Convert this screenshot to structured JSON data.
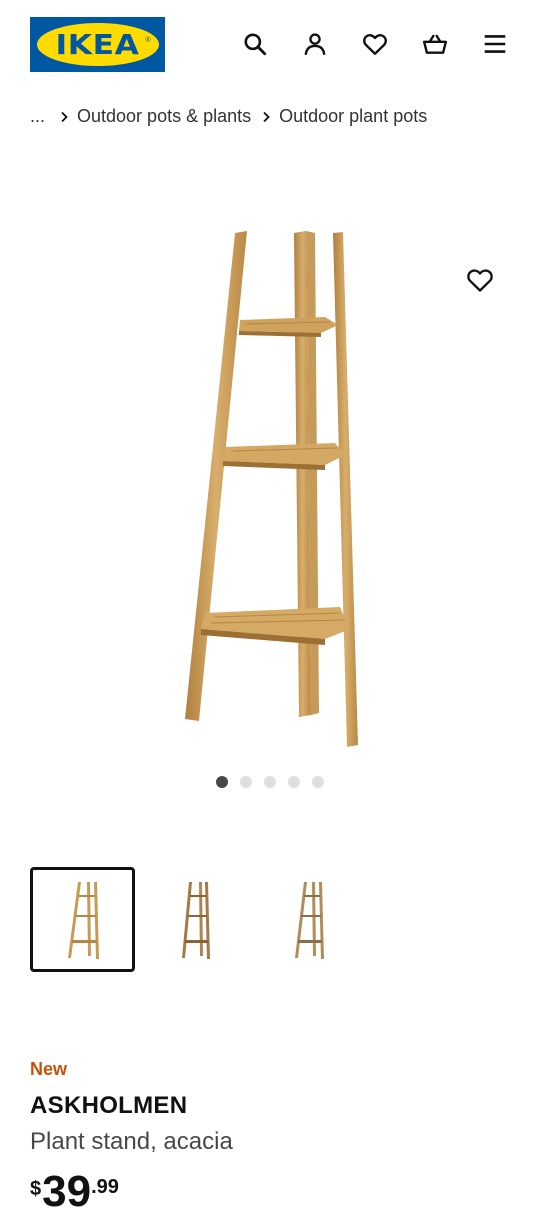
{
  "header": {
    "logo_text": "IKEA",
    "logo_mark": "®",
    "icons": [
      "search-icon",
      "account-icon",
      "heart-icon",
      "basket-icon",
      "menu-icon"
    ]
  },
  "breadcrumb": {
    "ellipsis": "...",
    "items": [
      "Outdoor pots & plants",
      "Outdoor plant pots"
    ]
  },
  "gallery": {
    "image_count": 5,
    "active_index": 0,
    "thumbnails_visible": 3,
    "selected_thumbnail": 0
  },
  "product": {
    "badge": "New",
    "name": "ASKHOLMEN",
    "description": "Plant stand, acacia",
    "price": {
      "currency": "$",
      "integer": "39",
      "decimal": ".99"
    }
  },
  "colors": {
    "ikea_blue": "#0058a3",
    "ikea_yellow": "#ffdb00",
    "new_badge": "#ca5008",
    "wood": "#c89a56"
  }
}
